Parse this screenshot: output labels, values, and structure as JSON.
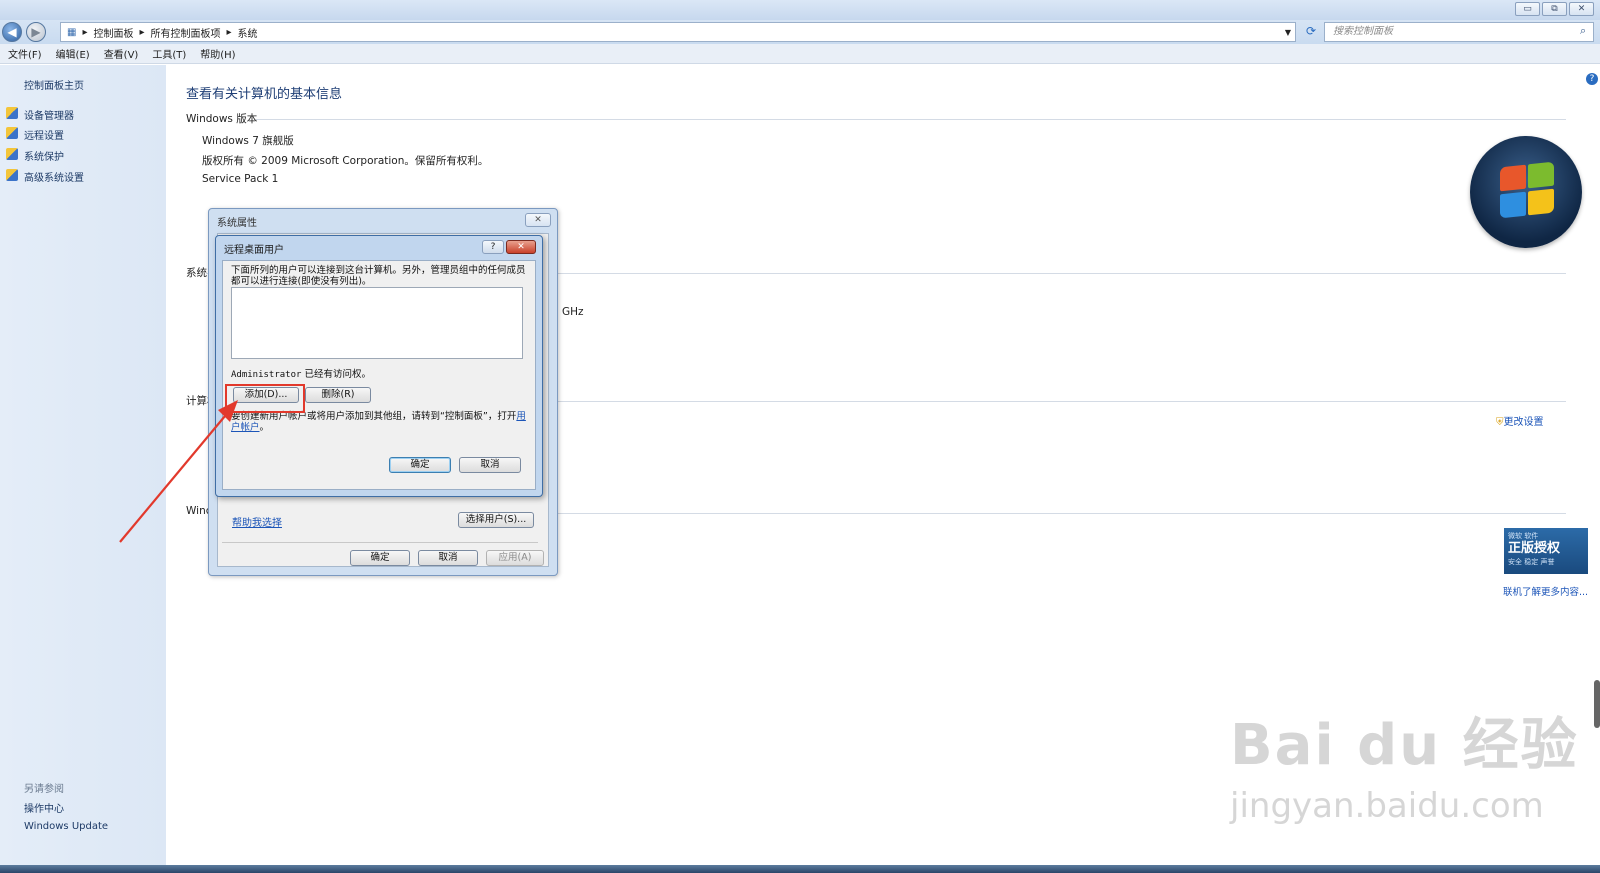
{
  "window": {
    "buttons": [
      "▭",
      "⧉",
      "✕"
    ]
  },
  "address_bar": {
    "back": "◀",
    "forward": "▶",
    "breadcrumb": [
      "控制面板",
      "所有控制面板项",
      "系统"
    ],
    "search_placeholder": "搜索控制面板"
  },
  "menu": [
    "文件(F)",
    "编辑(E)",
    "查看(V)",
    "工具(T)",
    "帮助(H)"
  ],
  "left_pane": {
    "home": "控制面板主页",
    "links": [
      "设备管理器",
      "远程设置",
      "系统保护",
      "高级系统设置"
    ],
    "see_also_title": "另请参阅",
    "see_also": [
      "操作中心",
      "Windows Update"
    ]
  },
  "main": {
    "title": "查看有关计算机的基本信息",
    "edition_header": "Windows 版本",
    "edition": "Windows 7 旗舰版",
    "copyright": "版权所有 © 2009 Microsoft Corporation。保留所有权利。",
    "service_pack": "Service Pack 1",
    "system_header": "系统",
    "cpu_tail": "0 GHz",
    "computer_header": "计算机",
    "activation_header": "Winc",
    "change_settings": "更改设置",
    "more_online": "联机了解更多内容...",
    "badge_top": "微软 软件",
    "badge_main": "正版授权",
    "badge_bottom": "安全 稳定 声誉"
  },
  "system_properties_dialog": {
    "title": "系统属性",
    "close": "✕",
    "help_link": "帮助我选择",
    "select_users": "选择用户(S)...",
    "ok": "确定",
    "cancel": "取消",
    "apply": "应用(A)"
  },
  "remote_users_dialog": {
    "title": "远程桌面用户",
    "help": "?",
    "close": "✕",
    "description": "下面所列的用户可以连接到这台计算机。另外，管理员组中的任何成员都可以进行连接(即使没有列出)。",
    "admin_name": "Administrator",
    "admin_status": "已经有访问权。",
    "add": "添加(D)...",
    "remove": "删除(R)",
    "hint_prefix": "要创建新用户帐户或将用户添加到其他组，请转到“控制面板”，打开",
    "hint_link": "用户帐户",
    "hint_suffix": "。",
    "ok": "确定",
    "cancel": "取消"
  },
  "watermark": {
    "brand": "Bai du 经验",
    "url": "jingyan.baidu.com"
  },
  "colors": {
    "highlight": "#e2392c",
    "link": "#1c55b8",
    "title_blue": "#1e3e75"
  }
}
